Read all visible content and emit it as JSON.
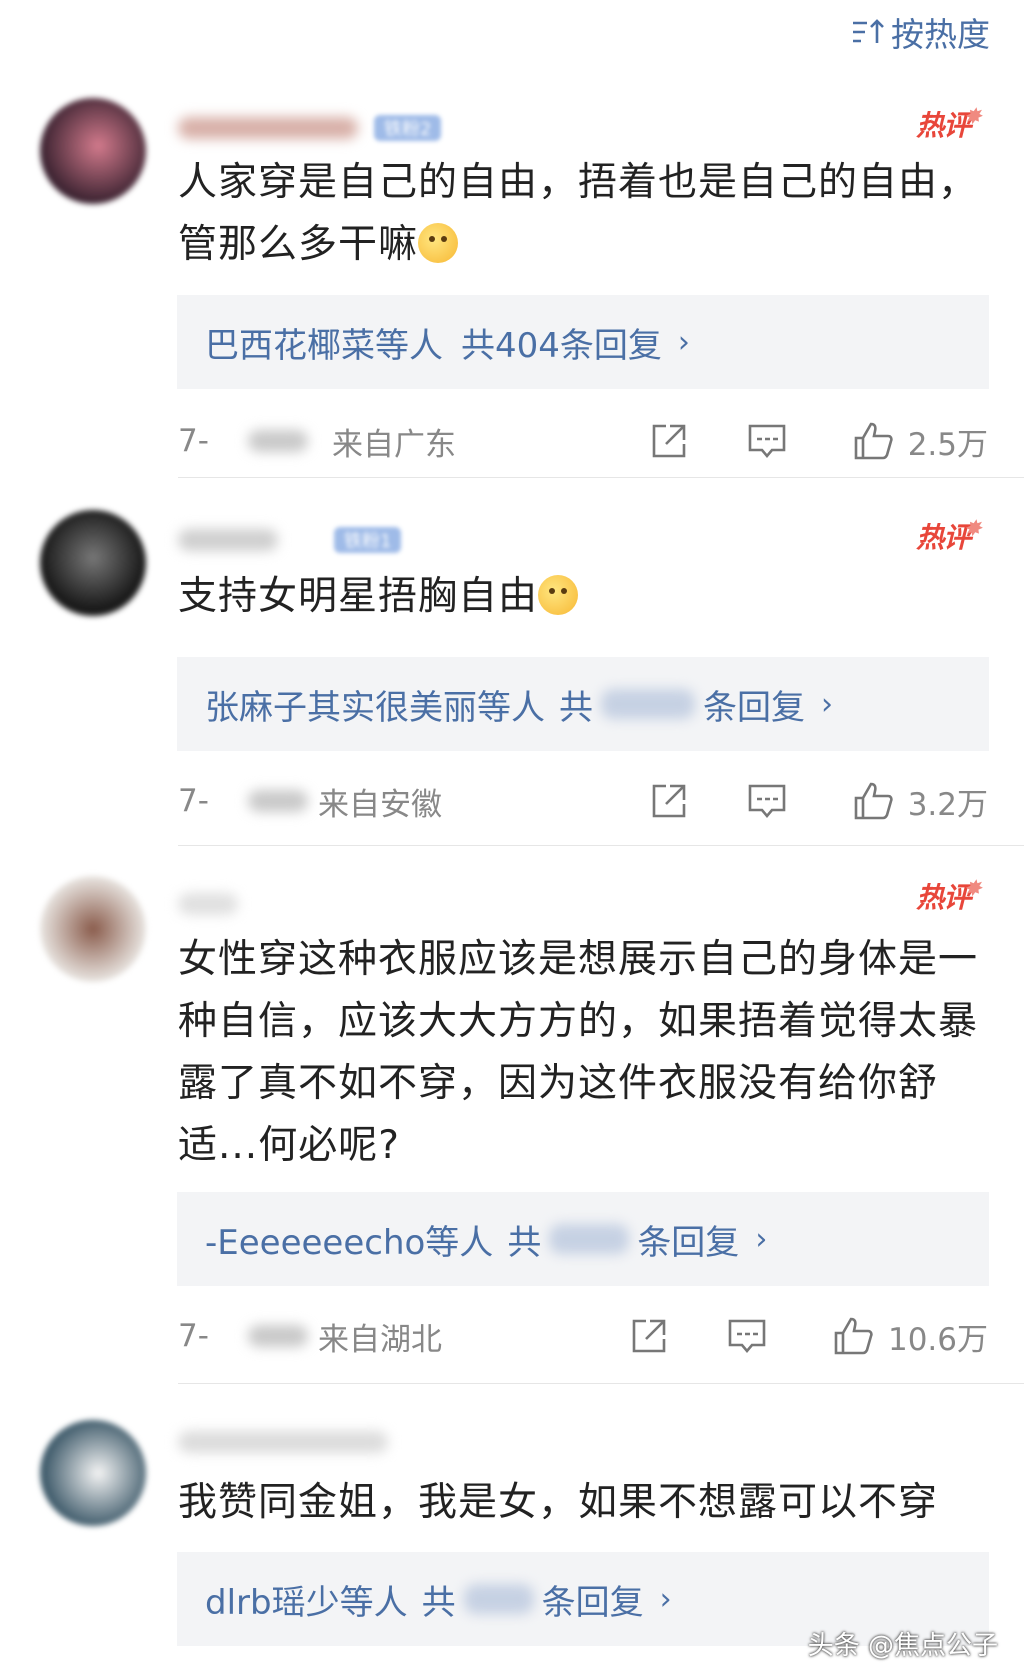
{
  "sort_label": "按热度",
  "hot_label": "热评",
  "comments": [
    {
      "text": "人家穿是自己的自由，捂着也是自己的自由，管那么多干嘛",
      "emoji": "doge-emoji",
      "badge": "铁粉2",
      "replies_prefix": "巴西花椰菜等人",
      "replies_count": "共404条回复",
      "date": "7-",
      "location": "来自广东",
      "likes": "2.5万"
    },
    {
      "text": "支持女明星捂胸自由",
      "emoji": "heart-emoji",
      "badge": "铁粉1",
      "replies_prefix": "张麻子其实很美丽等人",
      "replies_gong": "共",
      "replies_suffix": "条回复",
      "date": "7-",
      "location": "来自安徽",
      "likes": "3.2万"
    },
    {
      "text": "女性穿这种衣服应该是想展示自己的身体是一种自信，应该大大方方的，如果捂着觉得太暴露了真不如不穿，因为这件衣服没有给你舒适...何必呢?",
      "replies_prefix": "-Eeeeeeecho等人",
      "replies_gong": "共",
      "replies_suffix": "条回复",
      "date": "7-",
      "location": "来自湖北",
      "likes": "10.6万"
    },
    {
      "text": "我赞同金姐，我是女，如果不想露可以不穿",
      "replies_prefix": "dlrb瑶少等人",
      "replies_gong": "共",
      "replies_suffix": "条回复"
    }
  ],
  "watermark": "头条 @焦点公子",
  "colors": {
    "link": "#4a6fa5",
    "hot": "#e8463a",
    "reply_bg": "#f3f4f6"
  }
}
